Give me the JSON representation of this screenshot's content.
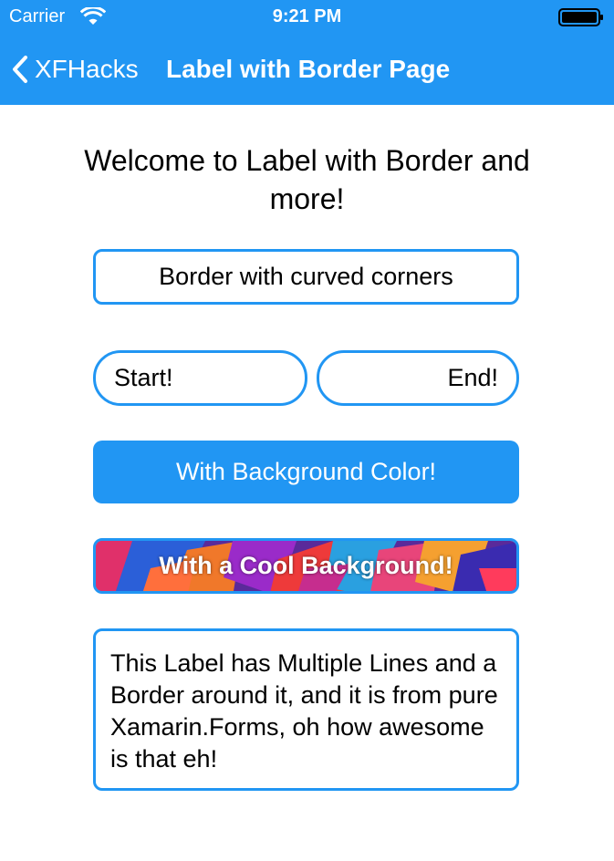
{
  "status_bar": {
    "carrier": "Carrier",
    "time": "9:21 PM",
    "wifi_icon": "wifi-icon",
    "battery_icon": "battery-icon"
  },
  "nav": {
    "back_label": "XFHacks",
    "back_icon": "chevron-left-icon",
    "title": "Label with Border Page"
  },
  "content": {
    "welcome": "Welcome to Label with Border and more!",
    "curved_label": "Border with curved corners",
    "start_label": "Start!",
    "end_label": "End!",
    "background_color_label": "With Background Color!",
    "cool_background_label": "With a Cool Background!",
    "multiline_label": "This Label has Multiple Lines and a Border around it, and it is from pure Xamarin.Forms, oh how awesome is that eh!"
  },
  "colors": {
    "accent": "#2196f3",
    "background": "#ffffff",
    "text": "#000000"
  }
}
